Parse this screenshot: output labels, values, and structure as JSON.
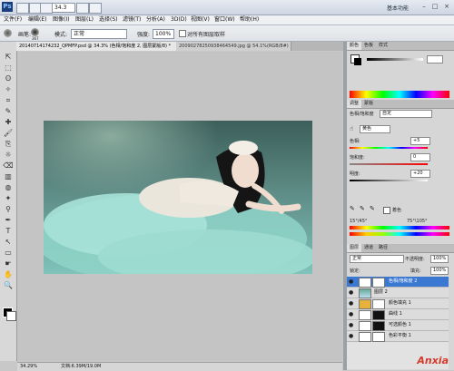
{
  "titlebar": {
    "logo": "Ps",
    "zoom": "34.3",
    "workspace": "基本功能",
    "window_controls": [
      "–",
      "□",
      "×"
    ]
  },
  "menu": [
    "文件(F)",
    "编辑(E)",
    "图像(I)",
    "图层(L)",
    "选择(S)",
    "滤镜(T)",
    "分析(A)",
    "3D(D)",
    "视图(V)",
    "窗口(W)",
    "帮助(H)"
  ],
  "options": {
    "size_label": "画笔:",
    "size_value": "367",
    "mode_label": "模式:",
    "mode_value": "正常",
    "flow_label": "强度:",
    "flow_value": "100%",
    "sample_all": "对所有图层取样"
  },
  "tabs": [
    {
      "label": "20140714174232_QPMFP.psd @ 34.3% (色相/饱和度 2, 图层蒙版/8) *",
      "active": true
    },
    {
      "label": "20090278250938464549.jpg @ 54.1%(RGB/8#)",
      "active": false
    }
  ],
  "tools": [
    "⇱",
    "⬚",
    "ʘ",
    "✧",
    "⌗",
    "✎",
    "✚",
    "🖌",
    "⎘",
    "☼",
    "⌫",
    "▥",
    "◍",
    "✦",
    "⚲",
    "✒",
    "T",
    "↖",
    "▭",
    "☛",
    "✋",
    "🔍"
  ],
  "status": {
    "zoom": "34.29%",
    "doc": "文档:6.39M/19.0M"
  },
  "panels": {
    "color_tabs": [
      "颜色",
      "色板",
      "样式"
    ],
    "adjust_tabs": [
      "调整",
      "蒙版"
    ],
    "hue_sat_title": "色相/饱和度",
    "preset": "自定",
    "channel": "黄色",
    "hue_label": "色相:",
    "hue_value": "+5",
    "sat_label": "饱和度:",
    "sat_value": "0",
    "light_label": "明度:",
    "light_value": "+20",
    "colorize_label": "着色",
    "range_left": "15°/45°",
    "range_right": "75°\\105°",
    "layers_tabs": [
      "图层",
      "通道",
      "路径"
    ],
    "blend_mode": "正常",
    "opacity_label": "不透明度:",
    "opacity_value": "100%",
    "lock_label": "锁定:",
    "fill_label": "填充:",
    "fill_value": "100%",
    "layers": [
      {
        "name": "色相/饱和度 2",
        "selected": true
      },
      {
        "name": "图层 2",
        "selected": false
      },
      {
        "name": "颜色填充 1",
        "selected": false
      },
      {
        "name": "曲线 1",
        "selected": false
      },
      {
        "name": "可选颜色 1",
        "selected": false
      },
      {
        "name": "色彩平衡 1",
        "selected": false
      }
    ]
  },
  "watermark": "Anxia"
}
